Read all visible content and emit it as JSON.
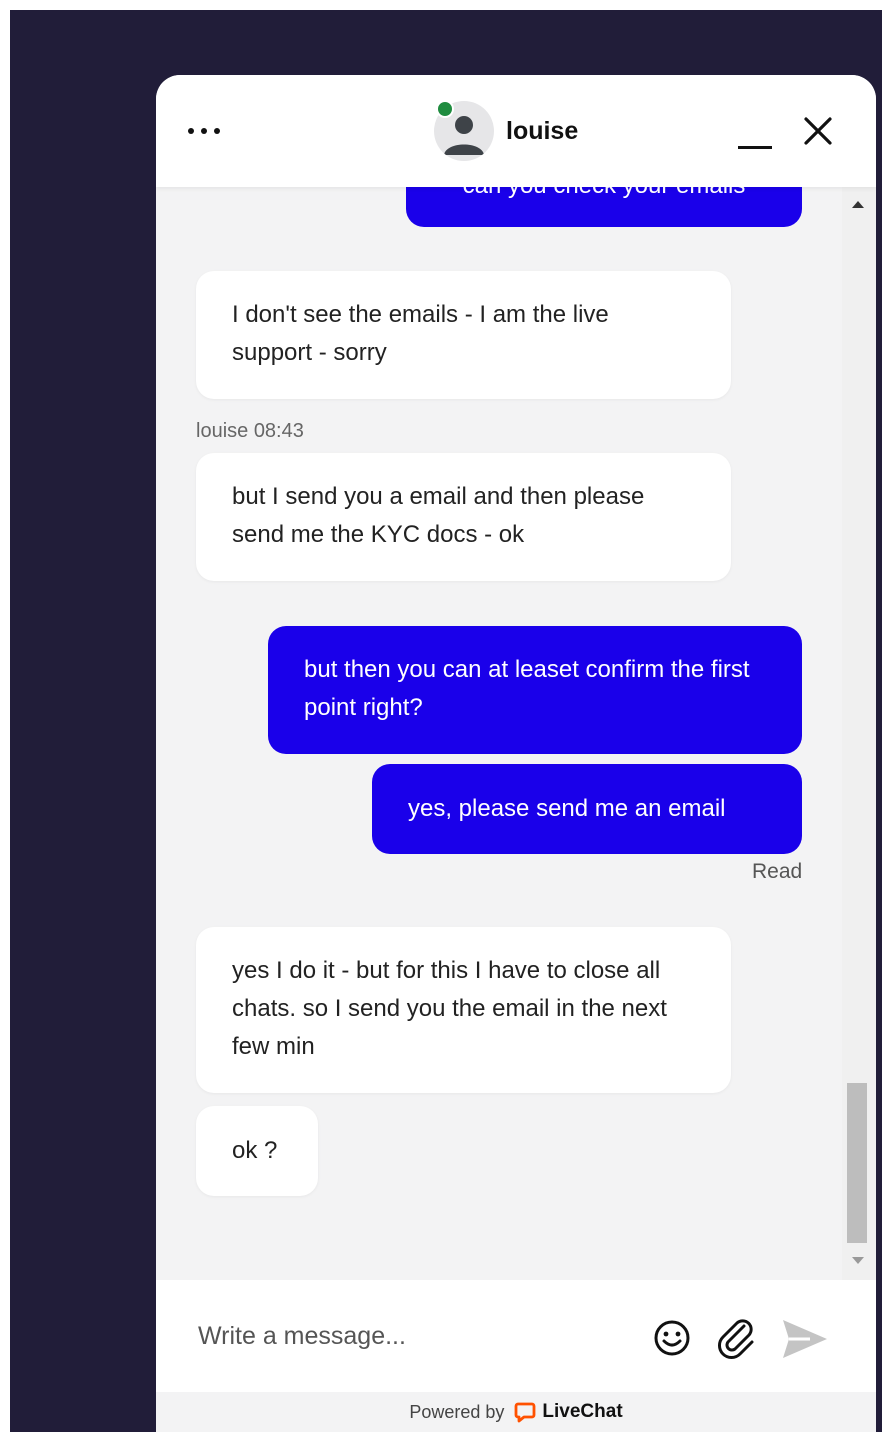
{
  "header": {
    "agent_name": "louise",
    "status": "online"
  },
  "messages": [
    {
      "from": "visitor",
      "text": "can you check your emails"
    },
    {
      "from": "agent",
      "text": "I don't see the emails - I am the live support - sorry"
    },
    {
      "meta": "louise 08:43"
    },
    {
      "from": "agent",
      "text": "but I send you a email and then please send me the KYC docs - ok"
    },
    {
      "from": "visitor",
      "text": "but then you can at leaset confirm the first point right?"
    },
    {
      "from": "visitor",
      "text": "yes, please send me an email"
    },
    {
      "receipt": "Read"
    },
    {
      "from": "agent",
      "text": "yes I do it - but for this I have to close all chats. so I send you the email in the next few min"
    },
    {
      "from": "agent",
      "text": "ok ?"
    }
  ],
  "composer": {
    "placeholder": "Write a message..."
  },
  "footer": {
    "powered_by": "Powered by",
    "brand": "LiveChat"
  },
  "colors": {
    "backdrop": "#211d39",
    "visitor_bubble": "#1a00ea",
    "agent_bubble": "#ffffff",
    "status_online": "#1f8c3f",
    "brand_accent": "#ff5100"
  },
  "icons": {
    "menu": "more-dots-icon",
    "minimize": "minimize-icon",
    "close": "close-icon",
    "emoji": "emoji-icon",
    "attach": "paperclip-icon",
    "send": "send-icon"
  }
}
